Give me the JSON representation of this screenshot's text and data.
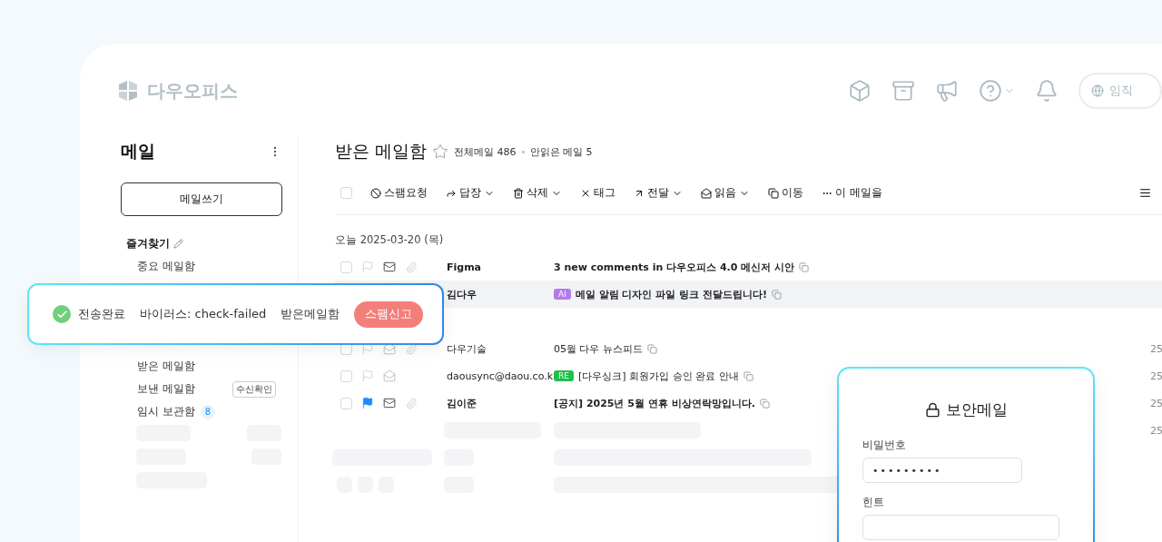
{
  "header": {
    "logo": "다우오피스",
    "search_text": "임직"
  },
  "sidebar": {
    "title": "메일",
    "compose": "메일쓰기",
    "favorites": {
      "label": "즐겨찾기",
      "items": [
        {
          "label": "중요 메일함"
        }
      ]
    },
    "folders": [
      {
        "label": "받은 메일함"
      },
      {
        "label": "보낸 메일함",
        "badge": "수신확인"
      },
      {
        "label": "임시 보관함",
        "count": "8"
      }
    ]
  },
  "mailbox": {
    "title": "받은 메일함",
    "starred": false,
    "total": "전체메일 486",
    "unread": "안읽은 메일 5"
  },
  "select_all": {
    "checked": false
  },
  "toolbar": [
    {
      "label": "스팸요청",
      "dropdown": false
    },
    {
      "label": "답장",
      "dropdown": true
    },
    {
      "label": "삭제",
      "dropdown": true
    },
    {
      "label": "태그",
      "dropdown": false
    },
    {
      "label": "전달",
      "dropdown": true
    },
    {
      "label": "읽음",
      "dropdown": true
    },
    {
      "label": "이동",
      "dropdown": false
    },
    {
      "label": "이 메일을",
      "dropdown": false
    }
  ],
  "date_group": "오늘 2025-03-20 (목)",
  "groups": [
    {
      "rows": [
        {
          "sender": "Figma",
          "subject": "3 new comments in 다우오피스 4.0 메신저 시안",
          "unread": true,
          "flagged": false,
          "attachment": true,
          "selected": false
        },
        {
          "sender": "김다우",
          "subject": "메일 알림 디자인 파일 링크 전달드립니다!",
          "unread": true,
          "selected": true,
          "tag": {
            "label": "AI",
            "color": "#b47be8"
          }
        }
      ]
    },
    {
      "rows": [
        {
          "sender": "다우기술",
          "subject": "05월 다우 뉴스피드",
          "unread": false,
          "flagged": false,
          "attachment": true,
          "selected": false,
          "date": "25"
        },
        {
          "sender": "daousync@daou.co.k",
          "subject": "[다우싱크] 회원가입 승인 완료 안내",
          "unread": false,
          "flagged": false,
          "attachment": false,
          "selected": false,
          "date": "25",
          "tag": {
            "label": "RE",
            "color": "#1fc04a"
          }
        },
        {
          "sender": "김이준",
          "subject": "[공지] 2025년 5월 연휴 비상연락망입니다.",
          "unread": true,
          "flagged": true,
          "attachment": true,
          "selected": false,
          "date": "25"
        }
      ]
    }
  ],
  "loading_dates": [
    "25"
  ],
  "toast": {
    "status": "전송완료",
    "virus": "바이러스: check-failed",
    "folder": "받은메일함",
    "action": "스팸신고"
  },
  "secure_dialog": {
    "title": "보안메일",
    "fields": [
      {
        "label": "비밀번호",
        "value": "•••••••••"
      },
      {
        "label": "힌트"
      }
    ]
  }
}
